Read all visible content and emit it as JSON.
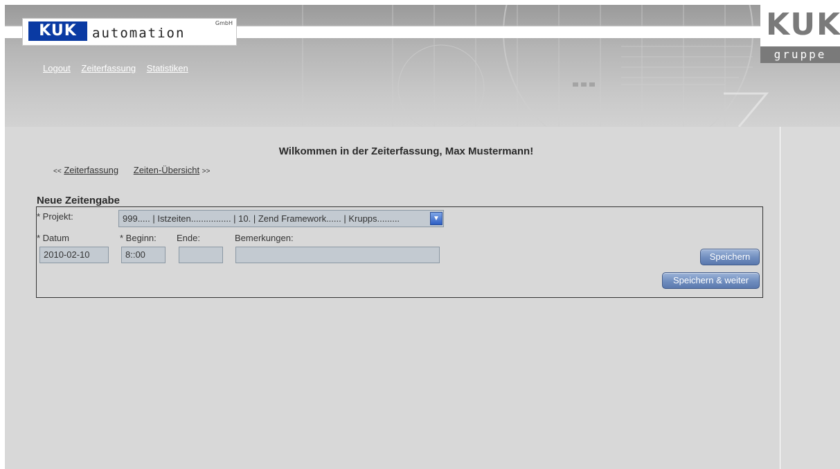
{
  "header": {
    "logo_mark": "KUK",
    "logo_text": "automation",
    "logo_suffix": "GmbH",
    "group_mark": "KUK",
    "group_label": "gruppe",
    "nav": [
      "Logout",
      "Zeiterfassung",
      "Statistiken"
    ]
  },
  "main": {
    "welcome": "Wilkommen in der Zeiterfassung, Max Mustermann!",
    "crumb_prev_arrow": "<<",
    "crumb_prev": "Zeiterfassung",
    "crumb_next": "Zeiten-Übersicht",
    "crumb_next_arrow": ">>",
    "section_title": "Neue Zeitengabe"
  },
  "form": {
    "projekt_label": "* Projekt:",
    "projekt_value": "999..... | Istzeiten................ | 10. | Zend Framework...... | Krupps.........",
    "datum_label": "* Datum",
    "datum_value": "2010-02-10",
    "beginn_label": "* Beginn:",
    "beginn_value": "8::00",
    "ende_label": "Ende:",
    "ende_value": "",
    "bemerkungen_label": "Bemerkungen:",
    "bemerkungen_value": "",
    "save_label": "Speichern",
    "save_next_label": "Speichern & weiter"
  },
  "colors": {
    "brand_blue": "#0a3aa3",
    "group_gray": "#7a7a7a",
    "page_bg": "#d8d8d8"
  }
}
